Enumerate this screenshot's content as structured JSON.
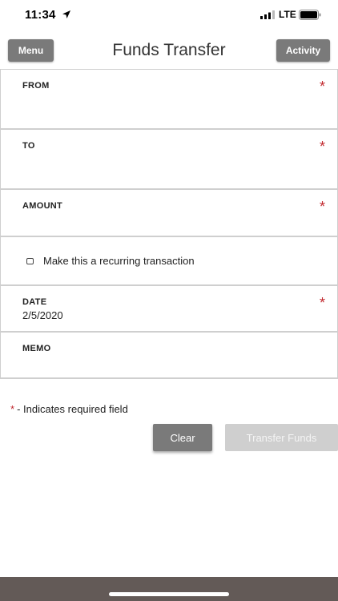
{
  "status_bar": {
    "time": "11:34",
    "network": "LTE",
    "icons": [
      "location-arrow-icon",
      "signal-bars-icon",
      "battery-icon"
    ]
  },
  "header": {
    "menu_label": "Menu",
    "title": "Funds Transfer",
    "activity_label": "Activity"
  },
  "form": {
    "from": {
      "label": "FROM",
      "required_marker": "*"
    },
    "to": {
      "label": "TO",
      "required_marker": "*"
    },
    "amount": {
      "label": "AMOUNT",
      "required_marker": "*"
    },
    "recurring": {
      "label": "Make this a recurring transaction",
      "checked": false
    },
    "date": {
      "label": "DATE",
      "value": "2/5/2020",
      "required_marker": "*"
    },
    "memo": {
      "label": "MEMO"
    }
  },
  "required_note": {
    "star": "*",
    "text": "- Indicates required field"
  },
  "actions": {
    "clear_label": "Clear",
    "transfer_label": "Transfer Funds"
  },
  "colors": {
    "button_gray": "#7a7a7a",
    "disabled_gray": "#cfcfcf",
    "required_red": "#c1272d",
    "bottom_bar": "#635a57"
  }
}
